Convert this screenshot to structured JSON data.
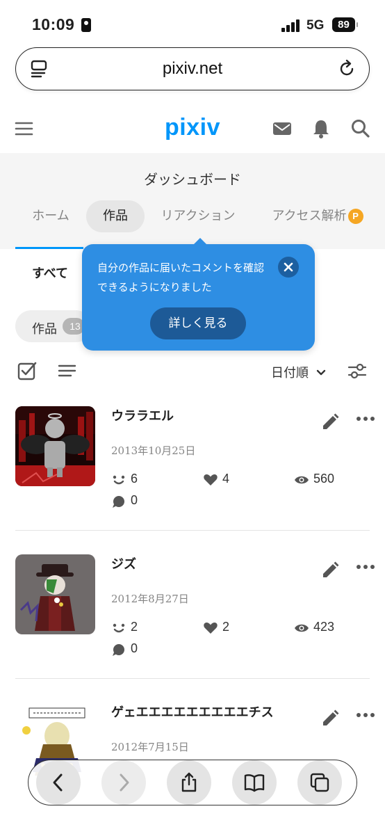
{
  "status": {
    "time": "10:09",
    "network": "5G",
    "battery": "89"
  },
  "browser": {
    "url": "pixiv.net"
  },
  "header": {
    "logo": "pixiv"
  },
  "dashboard": {
    "title": "ダッシュボード",
    "tabs": [
      {
        "label": "ホーム",
        "active": false
      },
      {
        "label": "作品",
        "active": true
      },
      {
        "label": "リアクション",
        "active": false
      },
      {
        "label": "アクセス解析",
        "active": false
      }
    ],
    "points_badge": "P"
  },
  "filter": {
    "subtab": "すべて",
    "chip_label": "作品",
    "chip_count": "13"
  },
  "tooltip": {
    "text": "自分の作品に届いたコメントを確認できるようになりました",
    "button": "詳しく見る"
  },
  "toolbar": {
    "sort_label": "日付順"
  },
  "works": [
    {
      "title": "ウララエル",
      "date": "2013年10月25日",
      "reactions": "6",
      "likes": "4",
      "views": "560",
      "comments": "0"
    },
    {
      "title": "ジズ",
      "date": "2012年8月27日",
      "reactions": "2",
      "likes": "2",
      "views": "423",
      "comments": "0"
    },
    {
      "title": "ゲェエエエエエエエエエチス",
      "date": "2012年7月15日"
    }
  ],
  "colors": {
    "brand": "#0096fa",
    "tooltip": "#2e8ee3",
    "tooltip_button": "#1d5a97"
  },
  "icons": [
    "menu-icon",
    "mail-icon",
    "bell-icon",
    "search-icon",
    "reader-icon",
    "reload-icon",
    "checkbox-icon",
    "list-icon",
    "chevron-down-icon",
    "filter-icon",
    "edit-icon",
    "more-icon",
    "close-icon",
    "back-icon",
    "forward-icon",
    "share-icon",
    "bookmarks-icon",
    "tabs-icon"
  ]
}
